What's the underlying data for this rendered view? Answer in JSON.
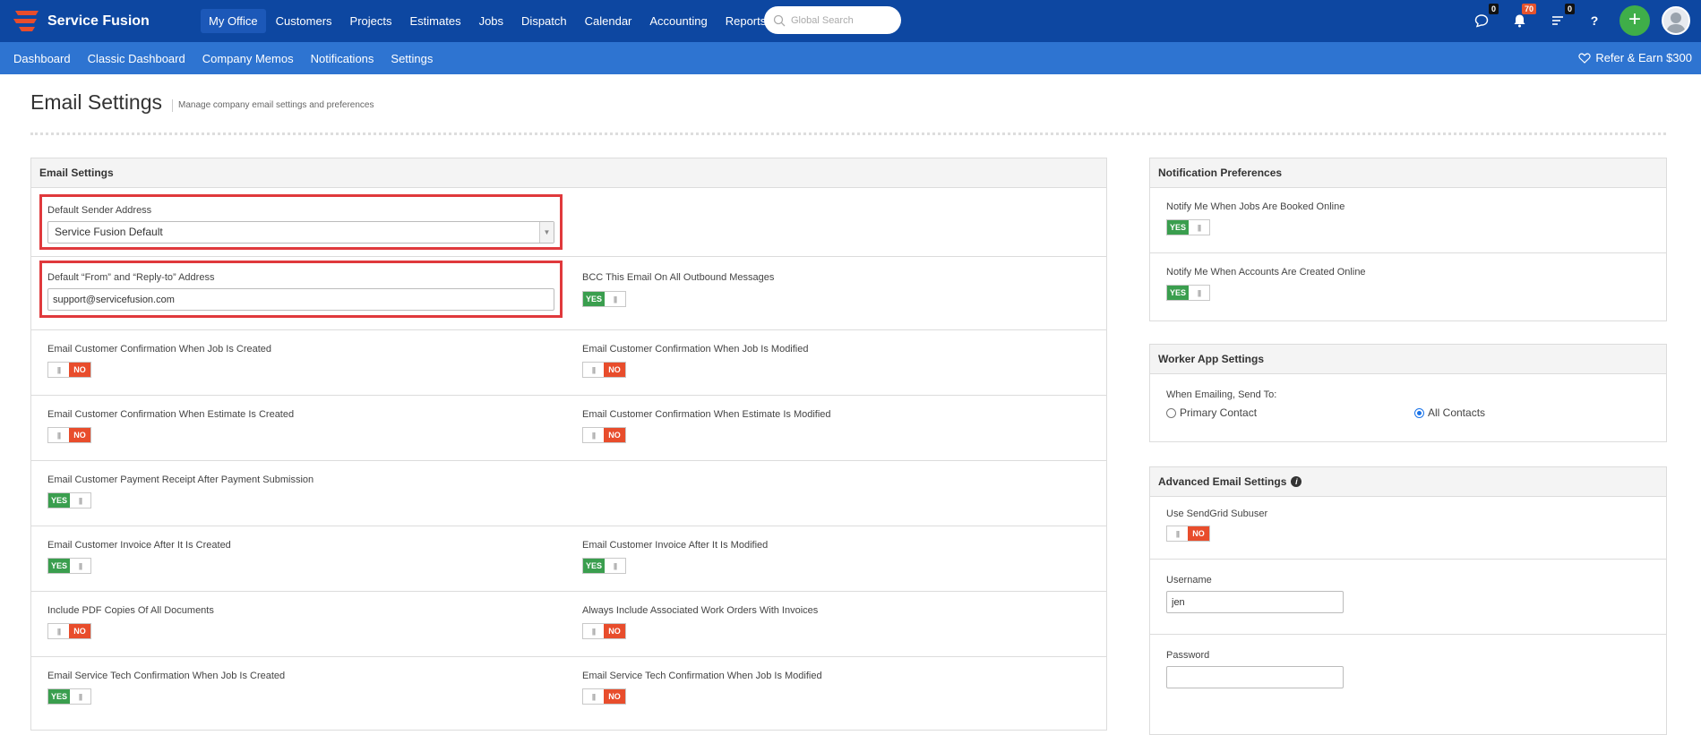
{
  "brand": {
    "name": "Service Fusion",
    "accent": "#e84d2c",
    "bar_color": "#0d47a1",
    "subbar_color": "#2e74d1"
  },
  "main_nav": [
    {
      "label": "My Office",
      "active": true
    },
    {
      "label": "Customers"
    },
    {
      "label": "Projects"
    },
    {
      "label": "Estimates"
    },
    {
      "label": "Jobs"
    },
    {
      "label": "Dispatch"
    },
    {
      "label": "Calendar"
    },
    {
      "label": "Accounting"
    },
    {
      "label": "Reports"
    }
  ],
  "search": {
    "placeholder": "Global Search"
  },
  "top_icons": {
    "chat_count": "0",
    "alerts_count": "70",
    "tasks_count": "0",
    "help": "?"
  },
  "sub_nav": [
    "Dashboard",
    "Classic Dashboard",
    "Company Memos",
    "Notifications",
    "Settings"
  ],
  "refer": "Refer & Earn $300",
  "page": {
    "title": "Email Settings",
    "subtitle": "Manage company email settings and preferences"
  },
  "email_settings": {
    "title": "Email Settings",
    "sender": {
      "label": "Default Sender Address",
      "value": "Service Fusion Default"
    },
    "from": {
      "label": "Default “From” and “Reply-to” Address",
      "value": "support@servicefusion.com"
    },
    "bcc": {
      "label": "BCC This Email On All Outbound Messages",
      "state": "YES"
    },
    "toggles": [
      {
        "label": "Email Customer Confirmation When Job Is Created",
        "state": "NO"
      },
      {
        "label": "Email Customer Confirmation When Job Is Modified",
        "state": "NO"
      },
      {
        "label": "Email Customer Confirmation When Estimate Is Created",
        "state": "NO"
      },
      {
        "label": "Email Customer Confirmation When Estimate Is Modified",
        "state": "NO"
      },
      {
        "label": "Email Customer Payment Receipt After Payment Submission",
        "state": "YES"
      },
      {
        "label": "Email Customer Invoice After It Is Created",
        "state": "YES"
      },
      {
        "label": "Email Customer Invoice After It Is Modified",
        "state": "YES"
      },
      {
        "label": "Include PDF Copies Of All Documents",
        "state": "NO"
      },
      {
        "label": "Always Include Associated Work Orders With Invoices",
        "state": "NO"
      },
      {
        "label": "Email Service Tech Confirmation When Job Is Created",
        "state": "YES"
      },
      {
        "label": "Email Service Tech Confirmation When Job Is Modified",
        "state": "NO"
      }
    ]
  },
  "notification_prefs": {
    "title": "Notification Preferences",
    "items": [
      {
        "label": "Notify Me When Jobs Are Booked Online",
        "state": "YES"
      },
      {
        "label": "Notify Me When Accounts Are Created Online",
        "state": "YES"
      }
    ]
  },
  "worker_app": {
    "title": "Worker App Settings",
    "label": "When Emailing, Send To:",
    "options": [
      "Primary Contact",
      "All Contacts"
    ],
    "selected": "All Contacts"
  },
  "advanced": {
    "title": "Advanced Email Settings",
    "sendgrid": {
      "label": "Use SendGrid Subuser",
      "state": "NO"
    },
    "username": {
      "label": "Username",
      "value": "jen"
    },
    "password": {
      "label": "Password",
      "value": ""
    }
  },
  "toggle_text": {
    "yes": "YES",
    "no": "NO"
  }
}
